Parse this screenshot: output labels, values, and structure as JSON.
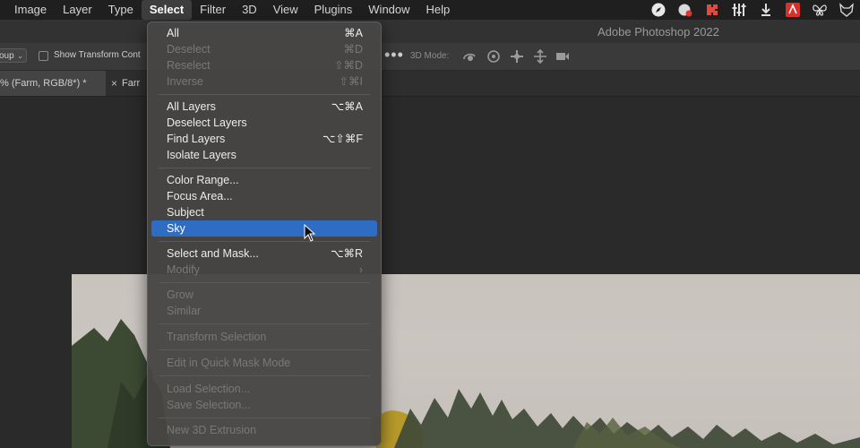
{
  "menubar": {
    "items": [
      "Image",
      "Layer",
      "Type",
      "Select",
      "Filter",
      "3D",
      "View",
      "Plugins",
      "Window",
      "Help"
    ],
    "active": "Select",
    "status_icons": [
      "compass-icon",
      "color-picker-icon",
      "puzzle-icon",
      "sliders-icon",
      "download-icon",
      "adobe-icon",
      "butterfly-icon",
      "fox-icon"
    ]
  },
  "titlebar": {
    "app_title": "Adobe Photoshop 2022"
  },
  "options_bar": {
    "group_label": "oup",
    "show_transform_label": "Show Transform Cont",
    "more": "•••",
    "mode_3d_label": "3D Mode:"
  },
  "tabs": [
    {
      "label": "% (Farm, RGB/8*) *"
    },
    {
      "label": "Farr"
    }
  ],
  "select_menu": {
    "items": [
      {
        "label": "All",
        "shortcut": "⌘A",
        "enabled": true
      },
      {
        "label": "Deselect",
        "shortcut": "⌘D",
        "enabled": false
      },
      {
        "label": "Reselect",
        "shortcut": "⇧⌘D",
        "enabled": false
      },
      {
        "label": "Inverse",
        "shortcut": "⇧⌘I",
        "enabled": false
      },
      {
        "label": "All Layers",
        "shortcut": "⌥⌘A",
        "enabled": true
      },
      {
        "label": "Deselect Layers",
        "shortcut": "",
        "enabled": true
      },
      {
        "label": "Find Layers",
        "shortcut": "⌥⇧⌘F",
        "enabled": true
      },
      {
        "label": "Isolate Layers",
        "shortcut": "",
        "enabled": true
      },
      {
        "label": "Color Range...",
        "shortcut": "",
        "enabled": true
      },
      {
        "label": "Focus Area...",
        "shortcut": "",
        "enabled": true
      },
      {
        "label": "Subject",
        "shortcut": "",
        "enabled": true
      },
      {
        "label": "Sky",
        "shortcut": "",
        "enabled": true,
        "highlighted": true
      },
      {
        "label": "Select and Mask...",
        "shortcut": "⌥⌘R",
        "enabled": true
      },
      {
        "label": "Modify",
        "shortcut": "›",
        "enabled": false
      },
      {
        "label": "Grow",
        "shortcut": "",
        "enabled": false
      },
      {
        "label": "Similar",
        "shortcut": "",
        "enabled": false
      },
      {
        "label": "Transform Selection",
        "shortcut": "",
        "enabled": false
      },
      {
        "label": "Edit in Quick Mask Mode",
        "shortcut": "",
        "enabled": false
      },
      {
        "label": "Load Selection...",
        "shortcut": "",
        "enabled": false
      },
      {
        "label": "Save Selection...",
        "shortcut": "",
        "enabled": false
      },
      {
        "label": "New 3D Extrusion",
        "shortcut": "",
        "enabled": false
      }
    ]
  },
  "colors": {
    "menu_highlight": "#2f6dc4",
    "menubar_bg": "#1f1f1f",
    "panel_bg": "#3a3a3a"
  }
}
